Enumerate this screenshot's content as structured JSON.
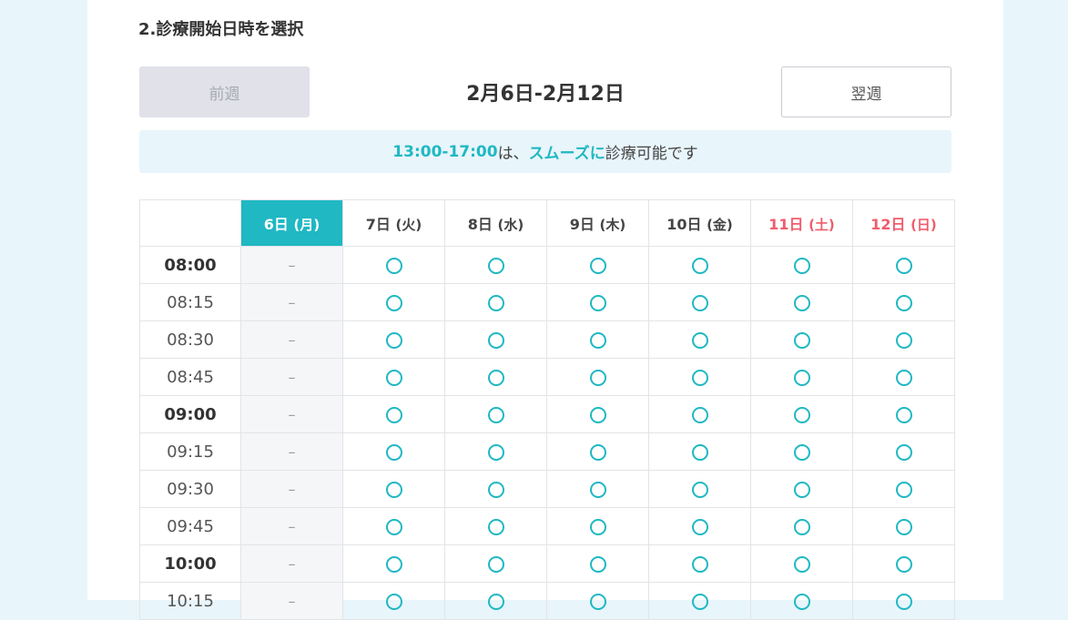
{
  "section_title": "2.診療開始日時を選択",
  "week_nav": {
    "prev_label": "前週",
    "range_label": "2月6日-2月12日",
    "next_label": "翌週"
  },
  "notice": {
    "time_range": "13:00-17:00",
    "text1": " は、",
    "smooth": "スムーズに",
    "text2": "診療可能です"
  },
  "colors": {
    "accent": "#1fb8c3",
    "weekend": "#ef5d6c",
    "disabled_bg": "#e0e1e9"
  },
  "table": {
    "days": [
      {
        "day": "6日",
        "dow": "(月)",
        "today": true,
        "weekend": false,
        "available": false
      },
      {
        "day": "7日",
        "dow": "(火)",
        "today": false,
        "weekend": false,
        "available": true
      },
      {
        "day": "8日",
        "dow": "(水)",
        "today": false,
        "weekend": false,
        "available": true
      },
      {
        "day": "9日",
        "dow": "(木)",
        "today": false,
        "weekend": false,
        "available": true
      },
      {
        "day": "10日",
        "dow": "(金)",
        "today": false,
        "weekend": false,
        "available": true
      },
      {
        "day": "11日",
        "dow": "(土)",
        "today": false,
        "weekend": true,
        "available": true
      },
      {
        "day": "12日",
        "dow": "(日)",
        "today": false,
        "weekend": true,
        "available": true
      }
    ],
    "unavailable_mark": "–",
    "times": [
      {
        "label": "08:00",
        "hour": true
      },
      {
        "label": "08:15",
        "hour": false
      },
      {
        "label": "08:30",
        "hour": false
      },
      {
        "label": "08:45",
        "hour": false
      },
      {
        "label": "09:00",
        "hour": true
      },
      {
        "label": "09:15",
        "hour": false
      },
      {
        "label": "09:30",
        "hour": false
      },
      {
        "label": "09:45",
        "hour": false
      },
      {
        "label": "10:00",
        "hour": true
      },
      {
        "label": "10:15",
        "hour": false
      }
    ]
  }
}
